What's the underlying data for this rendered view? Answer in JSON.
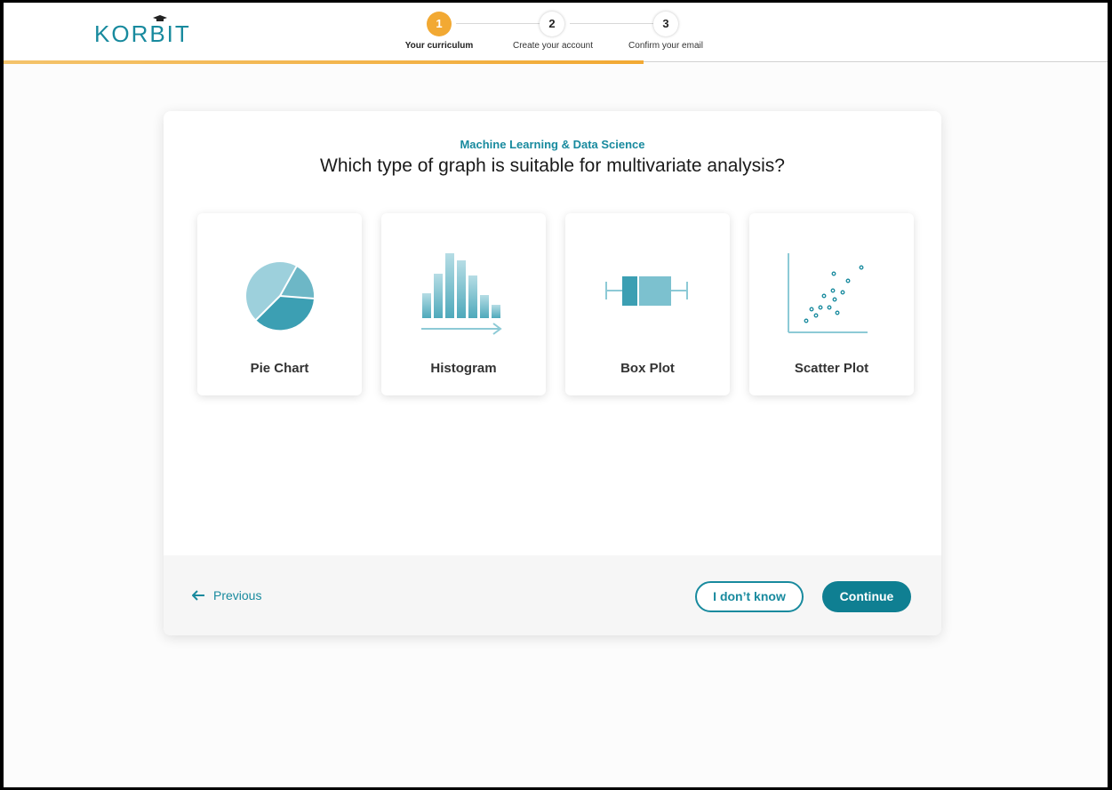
{
  "brand": {
    "name": "KORBIT",
    "color": "#188a9e"
  },
  "steps": [
    {
      "number": "1",
      "label": "Your curriculum",
      "state": "active"
    },
    {
      "number": "2",
      "label": "Create your account",
      "state": "inactive"
    },
    {
      "number": "3",
      "label": "Confirm your email",
      "state": "inactive"
    }
  ],
  "progress": {
    "fraction": 0.58
  },
  "question": {
    "subject": "Machine Learning & Data Science",
    "text": "Which type of graph is suitable for multivariate analysis?"
  },
  "options": [
    {
      "label": "Pie Chart",
      "icon": "pie-chart-icon"
    },
    {
      "label": "Histogram",
      "icon": "histogram-icon"
    },
    {
      "label": "Box Plot",
      "icon": "box-plot-icon"
    },
    {
      "label": "Scatter Plot",
      "icon": "scatter-plot-icon"
    }
  ],
  "footer": {
    "previous_label": "Previous",
    "dont_know_label": "I don’t know",
    "continue_label": "Continue"
  },
  "colors": {
    "accent": "#f2a933",
    "primary": "#0f7f92",
    "teal_light": "#8dcad6"
  }
}
